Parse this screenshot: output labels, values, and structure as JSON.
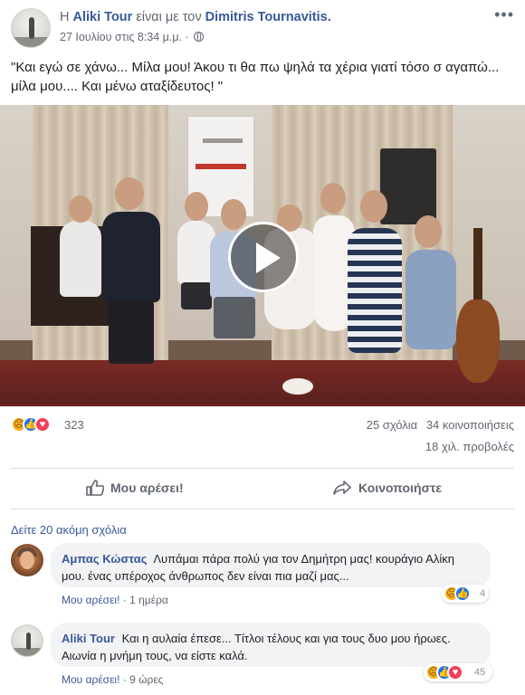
{
  "post": {
    "prefix": "Η",
    "author": "Aliki Tour",
    "with_text": "είναι με τον",
    "tagged": "Dimitris Tournavitis.",
    "timestamp": "27 Ιουλίου στις 8:34 μ.μ.",
    "separator": "·",
    "privacy_icon": "globe-icon",
    "text": "\"Και εγώ σε χάνω... Μίλα μου! Άκου τι θα πω ψηλά τα χέρια γιατί τόσο σ αγαπώ... μίλα μου.... Και μένω αταξίδευτος! \""
  },
  "stats": {
    "reaction_count": "323",
    "reaction_icons": [
      "sad-icon",
      "like-icon",
      "love-icon"
    ],
    "comments": "25 σχόλια",
    "shares": "34 κοινοποιήσεις",
    "views": "18 χιλ. προβολές"
  },
  "actions": {
    "like_label": "Μου αρέσει!",
    "share_label": "Κοινοποιήστε"
  },
  "more_comments": "Δείτε 20 ακόμη σχόλια",
  "comments": [
    {
      "author": "Αμπας Κώστας",
      "text": "Λυπάμαι πάρα πολύ για τον Δημήτρη μας! κουράγιο Αλίκη μου. ένας υπέροχος άνθρωπος δεν είναι πια μαζί μας...",
      "like_label": "Μου αρέσει!",
      "time": "1 ημέρα",
      "reaction_count": "4"
    },
    {
      "author": "Aliki Tour",
      "text": "Και η αυλαία έπεσε... Τίτλοι τέλους και για τους δυο μου ήρωες. Αιωνία η μνήμη τους, να είστε καλά.",
      "like_label": "Μου αρέσει!",
      "time": "9 ώρες",
      "reaction_count": "45"
    }
  ],
  "colors": {
    "link": "#385898",
    "meta": "#616770",
    "like_blue": "#1877f2",
    "love_red": "#f33e58",
    "sad_yellow": "#f7b125"
  }
}
